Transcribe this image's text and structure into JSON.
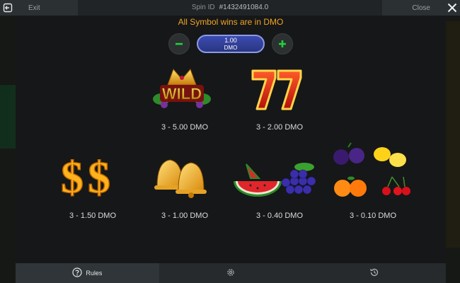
{
  "topbar": {
    "exit_label": "Exit",
    "spin_id_label": "Spin ID",
    "spin_id_value": "#1432491084.0",
    "close_label": "Close"
  },
  "rules": {
    "info_text": "All Symbol wins are in DMO",
    "bet": {
      "value": "1.00",
      "currency": "DMO"
    },
    "symbols": [
      {
        "icon": "wild-crown-icon",
        "pay": "3 - 5.00 DMO"
      },
      {
        "icon": "lucky-seven-icon",
        "pay": "3 - 2.00 DMO"
      },
      {
        "icon": "dollar-sign-icon",
        "pay": "3 - 1.50 DMO"
      },
      {
        "icon": "bells-icon",
        "pay": "3 - 1.00 DMO"
      },
      {
        "icon": "watermelon-grapes-icon",
        "pay": "3 - 0.40 DMO"
      },
      {
        "icon": "fruits-mix-icon",
        "pay": "3 - 0.10 DMO"
      }
    ],
    "wild_text": "WILD"
  },
  "tabs": [
    {
      "label": "Rules",
      "icon": "help-circle-icon",
      "active": true
    },
    {
      "label": "",
      "icon": "gear-icon",
      "active": false
    },
    {
      "label": "",
      "icon": "history-icon",
      "active": false
    }
  ],
  "colors": {
    "accent": "#f0a623",
    "plus_minus": "#1fd23a",
    "pill": "#3b4bb0"
  }
}
